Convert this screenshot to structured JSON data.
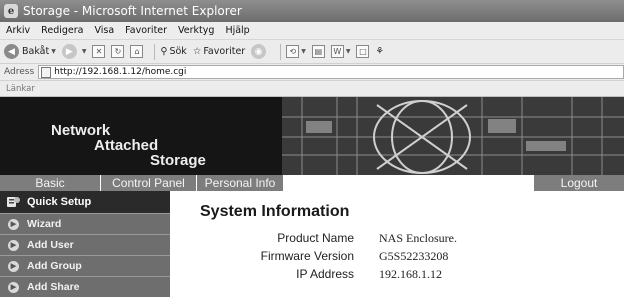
{
  "window": {
    "title": "Storage - Microsoft Internet Explorer"
  },
  "menu": [
    "Arkiv",
    "Redigera",
    "Visa",
    "Favoriter",
    "Verktyg",
    "Hjälp"
  ],
  "toolbar": {
    "back_label": "Bakåt",
    "search_label": "Sök",
    "favorites_label": "Favoriter"
  },
  "address": {
    "label": "Adress",
    "url": "http://192.168.1.12/home.cgi"
  },
  "links_label": "Länkar",
  "banner": {
    "logo_line1": "Network",
    "logo_line2": "Attached",
    "logo_line3": "Storage"
  },
  "tabs": {
    "basic": "Basic",
    "control_panel": "Control Panel",
    "personal_info": "Personal Info",
    "logout": "Logout"
  },
  "sidebar": {
    "header": "Quick Setup",
    "items": [
      "Wizard",
      "Add User",
      "Add Group",
      "Add Share"
    ]
  },
  "main": {
    "title": "System Information",
    "rows": [
      {
        "label": "Product Name",
        "value": "NAS Enclosure."
      },
      {
        "label": "Firmware Version",
        "value": "G5S52233208"
      },
      {
        "label": "IP Address",
        "value": "192.168.1.12"
      }
    ]
  },
  "colors": {
    "banner_bg": "#1e1e1e",
    "tab_bg": "#7d7d7d",
    "sidebar_header_bg": "#2a2a2a",
    "sidebar_item_bg": "#6e6e6e"
  }
}
